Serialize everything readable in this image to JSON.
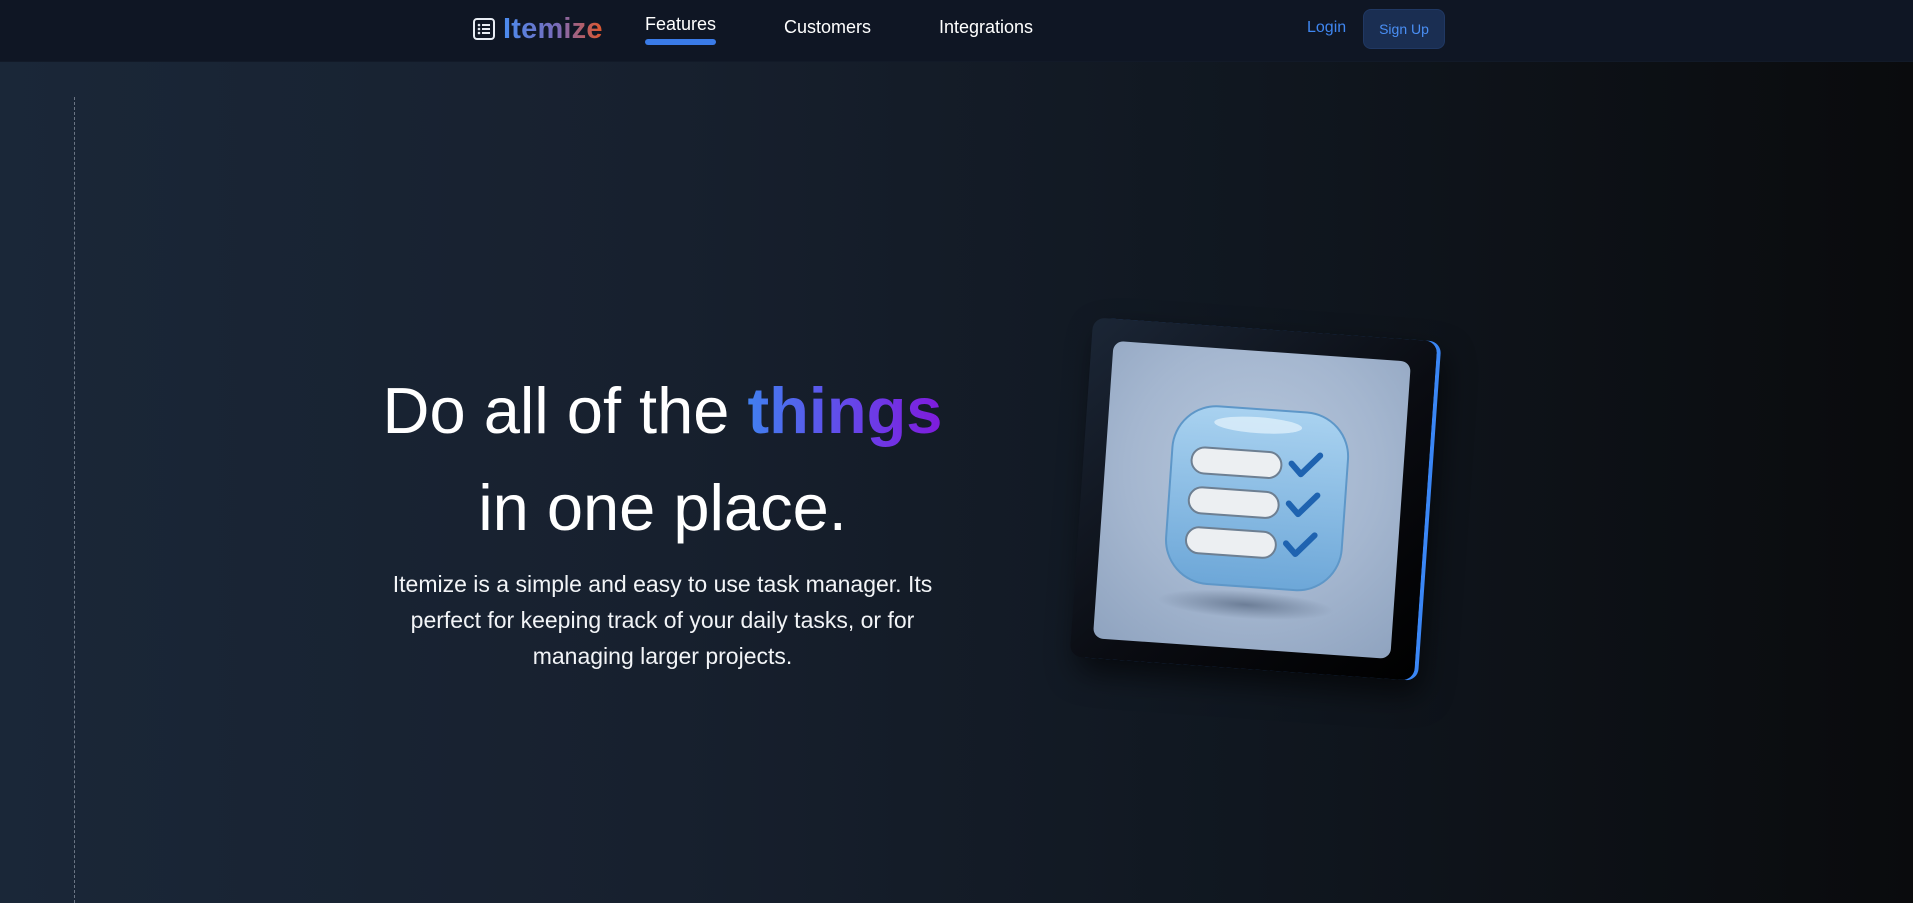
{
  "brand": {
    "name": "Itemize",
    "icon": "list-icon"
  },
  "nav": {
    "items": [
      {
        "label": "Features",
        "active": true
      },
      {
        "label": "Customers",
        "active": false
      },
      {
        "label": "Integrations",
        "active": false
      }
    ],
    "login_label": "Login",
    "signup_label": "Sign Up"
  },
  "hero": {
    "title_before": "Do all of the ",
    "title_accent": "things",
    "title_after": "in one place.",
    "subtitle": "Itemize is a simple and easy to use task manager. Its perfect for keeping track of your daily tasks, or for managing larger projects."
  },
  "illustration": {
    "icon": "checklist-icon"
  },
  "colors": {
    "accent_blue": "#3a7be8",
    "accent_purple": "#7f1bdc",
    "brand_orange": "#e0562a",
    "nav_bg": "#0f1624",
    "signup_bg": "#1a2e52"
  }
}
